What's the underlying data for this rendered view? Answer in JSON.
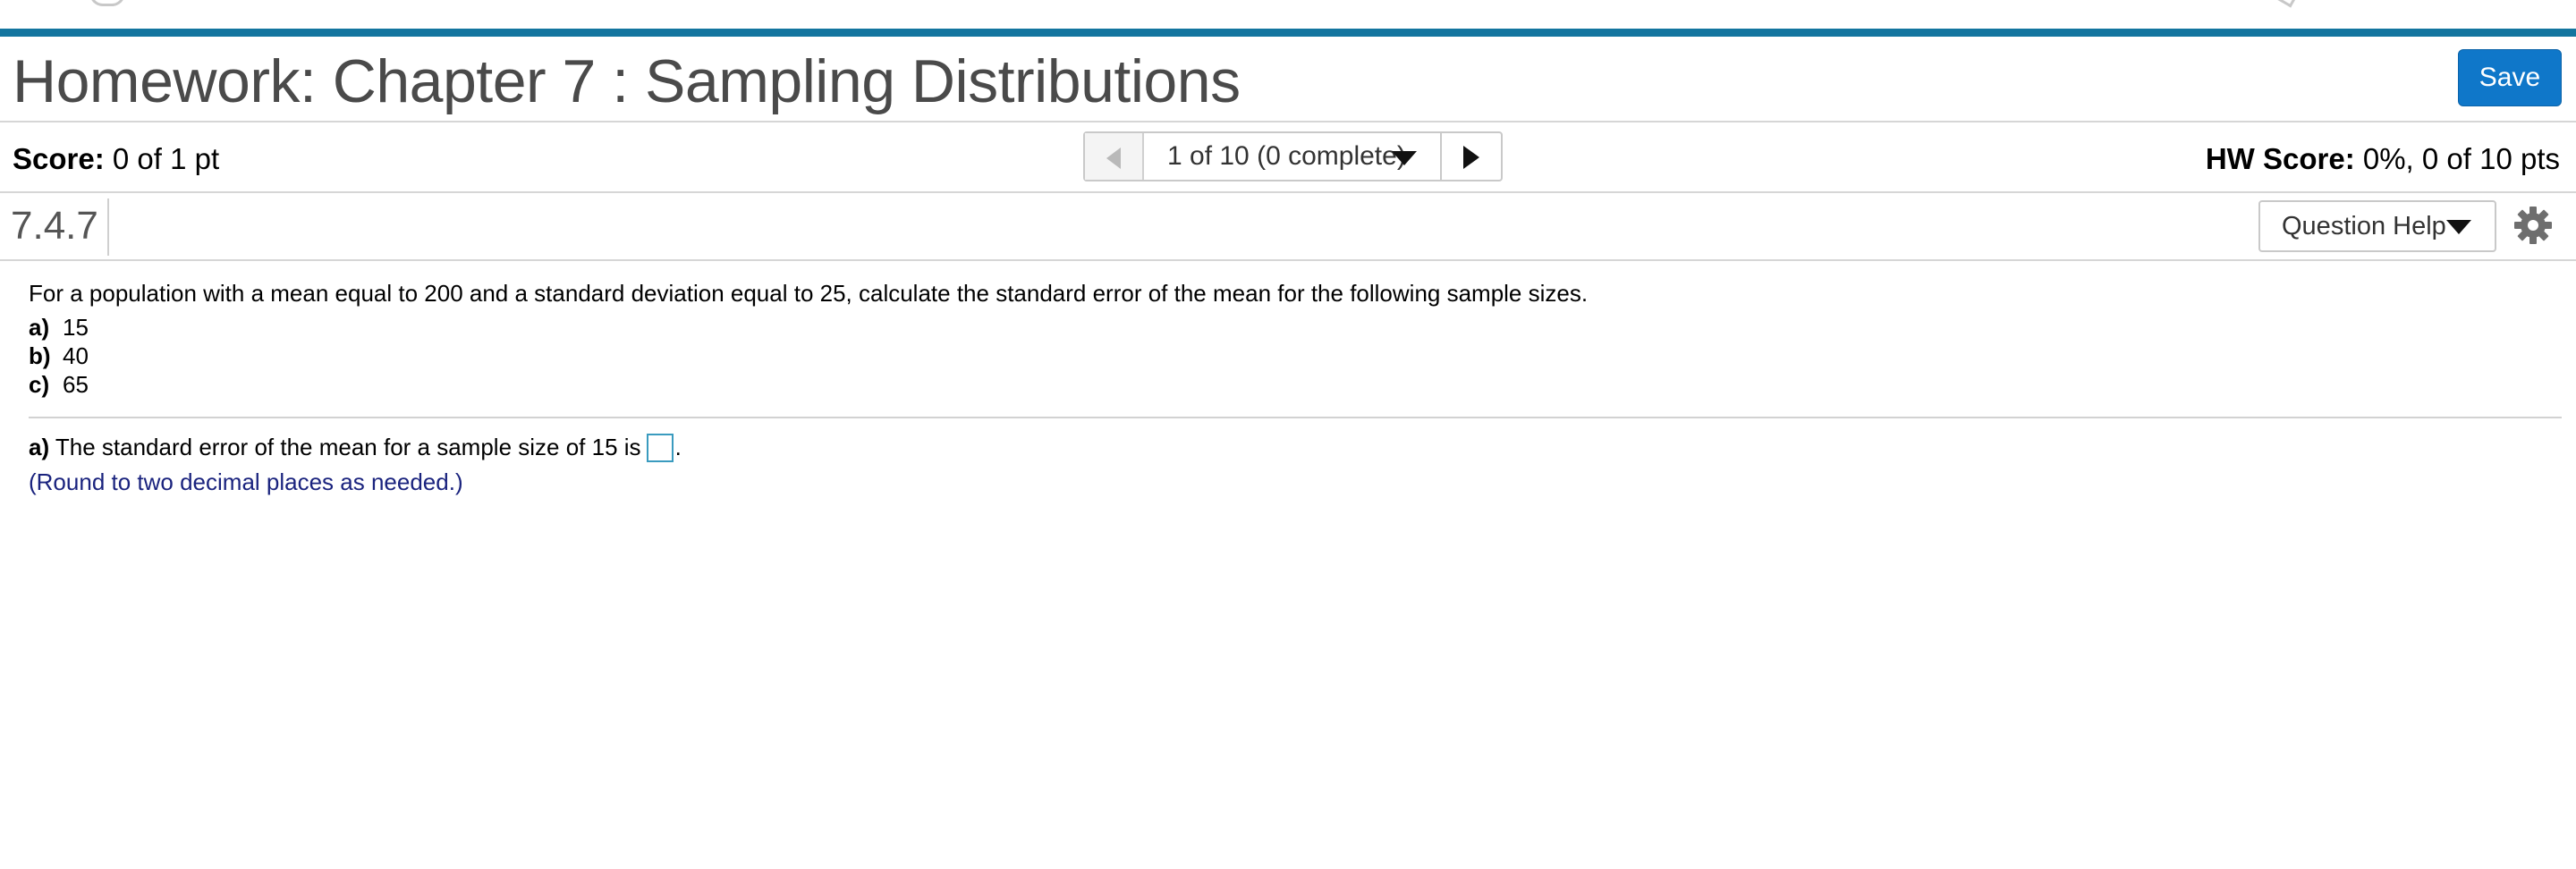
{
  "header": {
    "title": "Homework: Chapter 7 : Sampling Distributions",
    "save_label": "Save",
    "accent_color": "#13759f",
    "save_button_color": "#0f77c9"
  },
  "score_bar": {
    "score_label": "Score:",
    "score_value": "0 of 1 pt",
    "nav_label": "1 of 10 (0 complete)",
    "hw_score_label": "HW Score:",
    "hw_score_value": "0%, 0 of 10 pts"
  },
  "question_bar": {
    "question_id": "7.4.7",
    "help_label": "Question Help"
  },
  "question": {
    "stem": "For a population with a mean equal to 200 and a standard deviation equal to 25, calculate the standard error of the mean for the following sample sizes.",
    "parts": [
      {
        "letter": "a)",
        "value": "15"
      },
      {
        "letter": "b)",
        "value": "40"
      },
      {
        "letter": "c)",
        "value": "65"
      }
    ]
  },
  "answer": {
    "letter": "a)",
    "prompt": "The standard error of the mean for a sample size of 15 is",
    "input_value": "",
    "trailing": ".",
    "note": "(Round to two decimal places as needed.)",
    "note_color": "#1a237e"
  },
  "icons": {
    "prev": "triangle-left-icon",
    "next": "triangle-right-icon",
    "dropdown": "caret-down-icon",
    "settings": "gear-icon"
  }
}
